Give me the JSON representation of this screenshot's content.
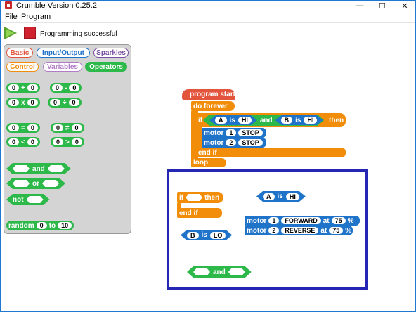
{
  "window": {
    "title": "Crumble Version 0.25.2",
    "min": "—",
    "max": "☐",
    "close": "✕"
  },
  "menu": {
    "file_u": "F",
    "file_rest": "ile",
    "program_u": "P",
    "program_rest": "rogram"
  },
  "toolbar": {
    "status": "Programming successful",
    "colors": {
      "run": "#5aa42c",
      "stop": "#d0212e"
    }
  },
  "palette": {
    "tabs": {
      "basic": "Basic",
      "io": "Input/Output",
      "sparkles": "Sparkles",
      "control": "Control",
      "variables": "Variables",
      "operators": "Operators"
    },
    "tab_colors": {
      "basic": "#e2543c",
      "io": "#1f73c8",
      "sparkles": "#7a4fa0",
      "control": "#f28d0a",
      "variables": "#b07cc8",
      "operators": "#2db84a"
    },
    "ops": {
      "add": {
        "a": "0",
        "op": "+",
        "b": "0"
      },
      "sub": {
        "a": "0",
        "op": "-",
        "b": "0"
      },
      "mul": {
        "a": "0",
        "op": "x",
        "b": "0"
      },
      "div": {
        "a": "0",
        "op": "÷",
        "b": "0"
      },
      "eq": {
        "a": "0",
        "op": "=",
        "b": "0"
      },
      "ne": {
        "a": "0",
        "op": "≠",
        "b": "0"
      },
      "lt": {
        "a": "0",
        "op": "<",
        "b": "0"
      },
      "gt": {
        "a": "0",
        "op": ">",
        "b": "0"
      }
    },
    "and": "and",
    "or": "or",
    "not": "not",
    "random": {
      "label": "random",
      "from": "0",
      "to_label": "to",
      "to": "10"
    }
  },
  "program": {
    "start": "program start",
    "forever": "do forever",
    "if": "if",
    "cond_a_var": "A",
    "is1": "is",
    "cond_a_val": "HI",
    "and": "and",
    "cond_b_var": "B",
    "is2": "is",
    "cond_b_val": "HI",
    "then": "then",
    "motor": "motor",
    "m1": "1",
    "m1_action": "STOP",
    "m2": "2",
    "m2_action": "STOP",
    "end_if": "end if",
    "loop": "loop"
  },
  "loose": {
    "if": "if",
    "then": "then",
    "end_if": "end if",
    "a_var": "A",
    "a_is": "is",
    "a_val": "HI",
    "b_var": "B",
    "b_is": "is",
    "b_val": "LO",
    "motor1": {
      "label": "motor",
      "num": "1",
      "dir": "FORWARD",
      "at": "at",
      "speed": "75",
      "pct": "%"
    },
    "motor2": {
      "label": "motor",
      "num": "2",
      "dir": "REVERSE",
      "at": "at",
      "speed": "75",
      "pct": "%"
    },
    "and": "and"
  }
}
